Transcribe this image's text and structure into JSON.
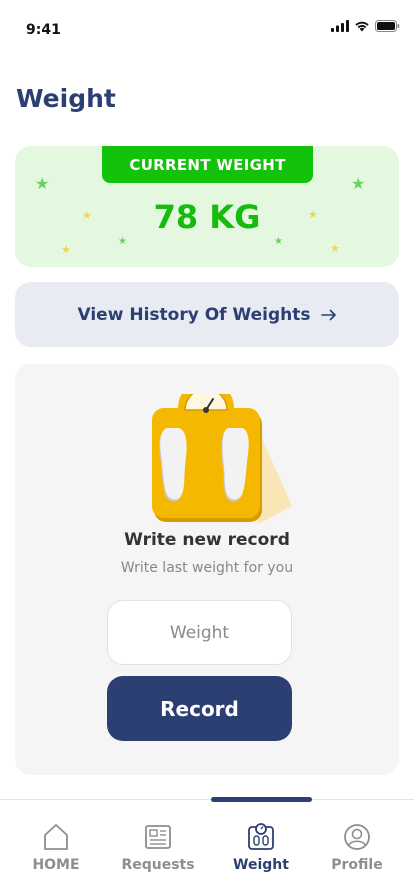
{
  "status_bar": {
    "time": "9:41"
  },
  "page": {
    "title": "Weight"
  },
  "current_weight": {
    "tag": "CURRENT WEIGHT",
    "value": "78 KG"
  },
  "history": {
    "label": "View History Of Weights",
    "arrow": "→"
  },
  "record": {
    "title": "Write new record",
    "subtitle": "Write last weight for you",
    "input_placeholder": "Weight",
    "input_value": "",
    "button_label": "Record"
  },
  "nav": {
    "active": "Weight",
    "items": [
      {
        "label": "HOME",
        "icon": "home-icon"
      },
      {
        "label": "Requests",
        "icon": "requests-icon"
      },
      {
        "label": "Weight",
        "icon": "weight-scale-icon"
      },
      {
        "label": "Profile",
        "icon": "profile-icon"
      }
    ]
  },
  "colors": {
    "primary": "#2b3f72",
    "green": "#13c20a",
    "card_green_bg": "#e3f8de",
    "scale_yellow": "#f5b800"
  }
}
